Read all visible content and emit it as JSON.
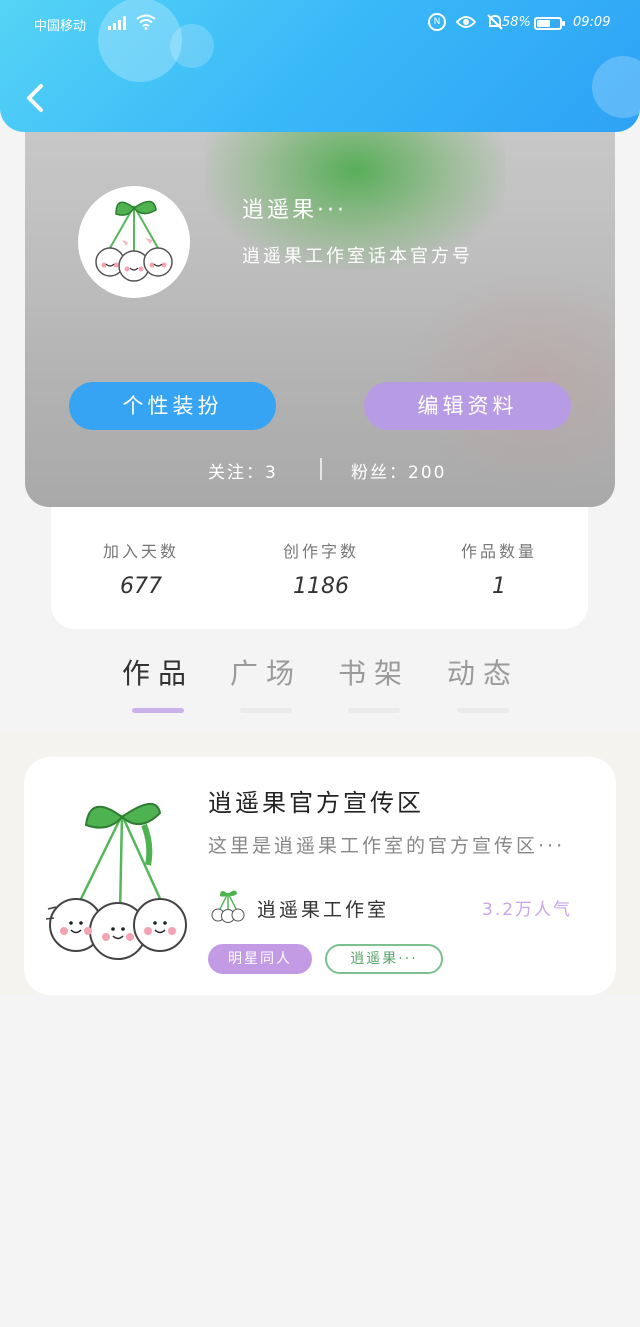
{
  "status_bar": {
    "carrier": "中国移动",
    "battery_pct": "58%",
    "battery_level": 0.58,
    "time": "09:09",
    "icons": [
      "signal-icon",
      "wifi-icon",
      "nfc-icon",
      "eye-protect-icon",
      "mute-icon",
      "battery-icon"
    ]
  },
  "header": {
    "back_icon": "back-chevron-icon",
    "bg_colors": [
      "#55d4f6",
      "#2ea2f5"
    ]
  },
  "profile": {
    "name": "逍遥果···",
    "bio": "逍遥果工作室话本官方号",
    "dress_button": "个性装扮",
    "edit_button": "编辑资料",
    "follow_label": "关注：3",
    "fans_label": "粉丝：200"
  },
  "stats": [
    {
      "label": "加入天数",
      "value": "677"
    },
    {
      "label": "创作字数",
      "value": "1186"
    },
    {
      "label": "作品数量",
      "value": "1"
    }
  ],
  "tabs": [
    {
      "label": "作品",
      "active": true
    },
    {
      "label": "广场",
      "active": false
    },
    {
      "label": "书架",
      "active": false
    },
    {
      "label": "动态",
      "active": false
    }
  ],
  "works": [
    {
      "title": "逍遥果官方宣传区",
      "description": "这里是逍遥果工作室的官方宣传区···",
      "author": "逍遥果工作室",
      "popularity": "3.2万人气",
      "tags": [
        "明星同人",
        "逍遥果···"
      ]
    }
  ],
  "colors": {
    "accent_blue": "#36a4f3",
    "accent_purple": "#b89be5",
    "tab_active": "#c9b1ea"
  }
}
